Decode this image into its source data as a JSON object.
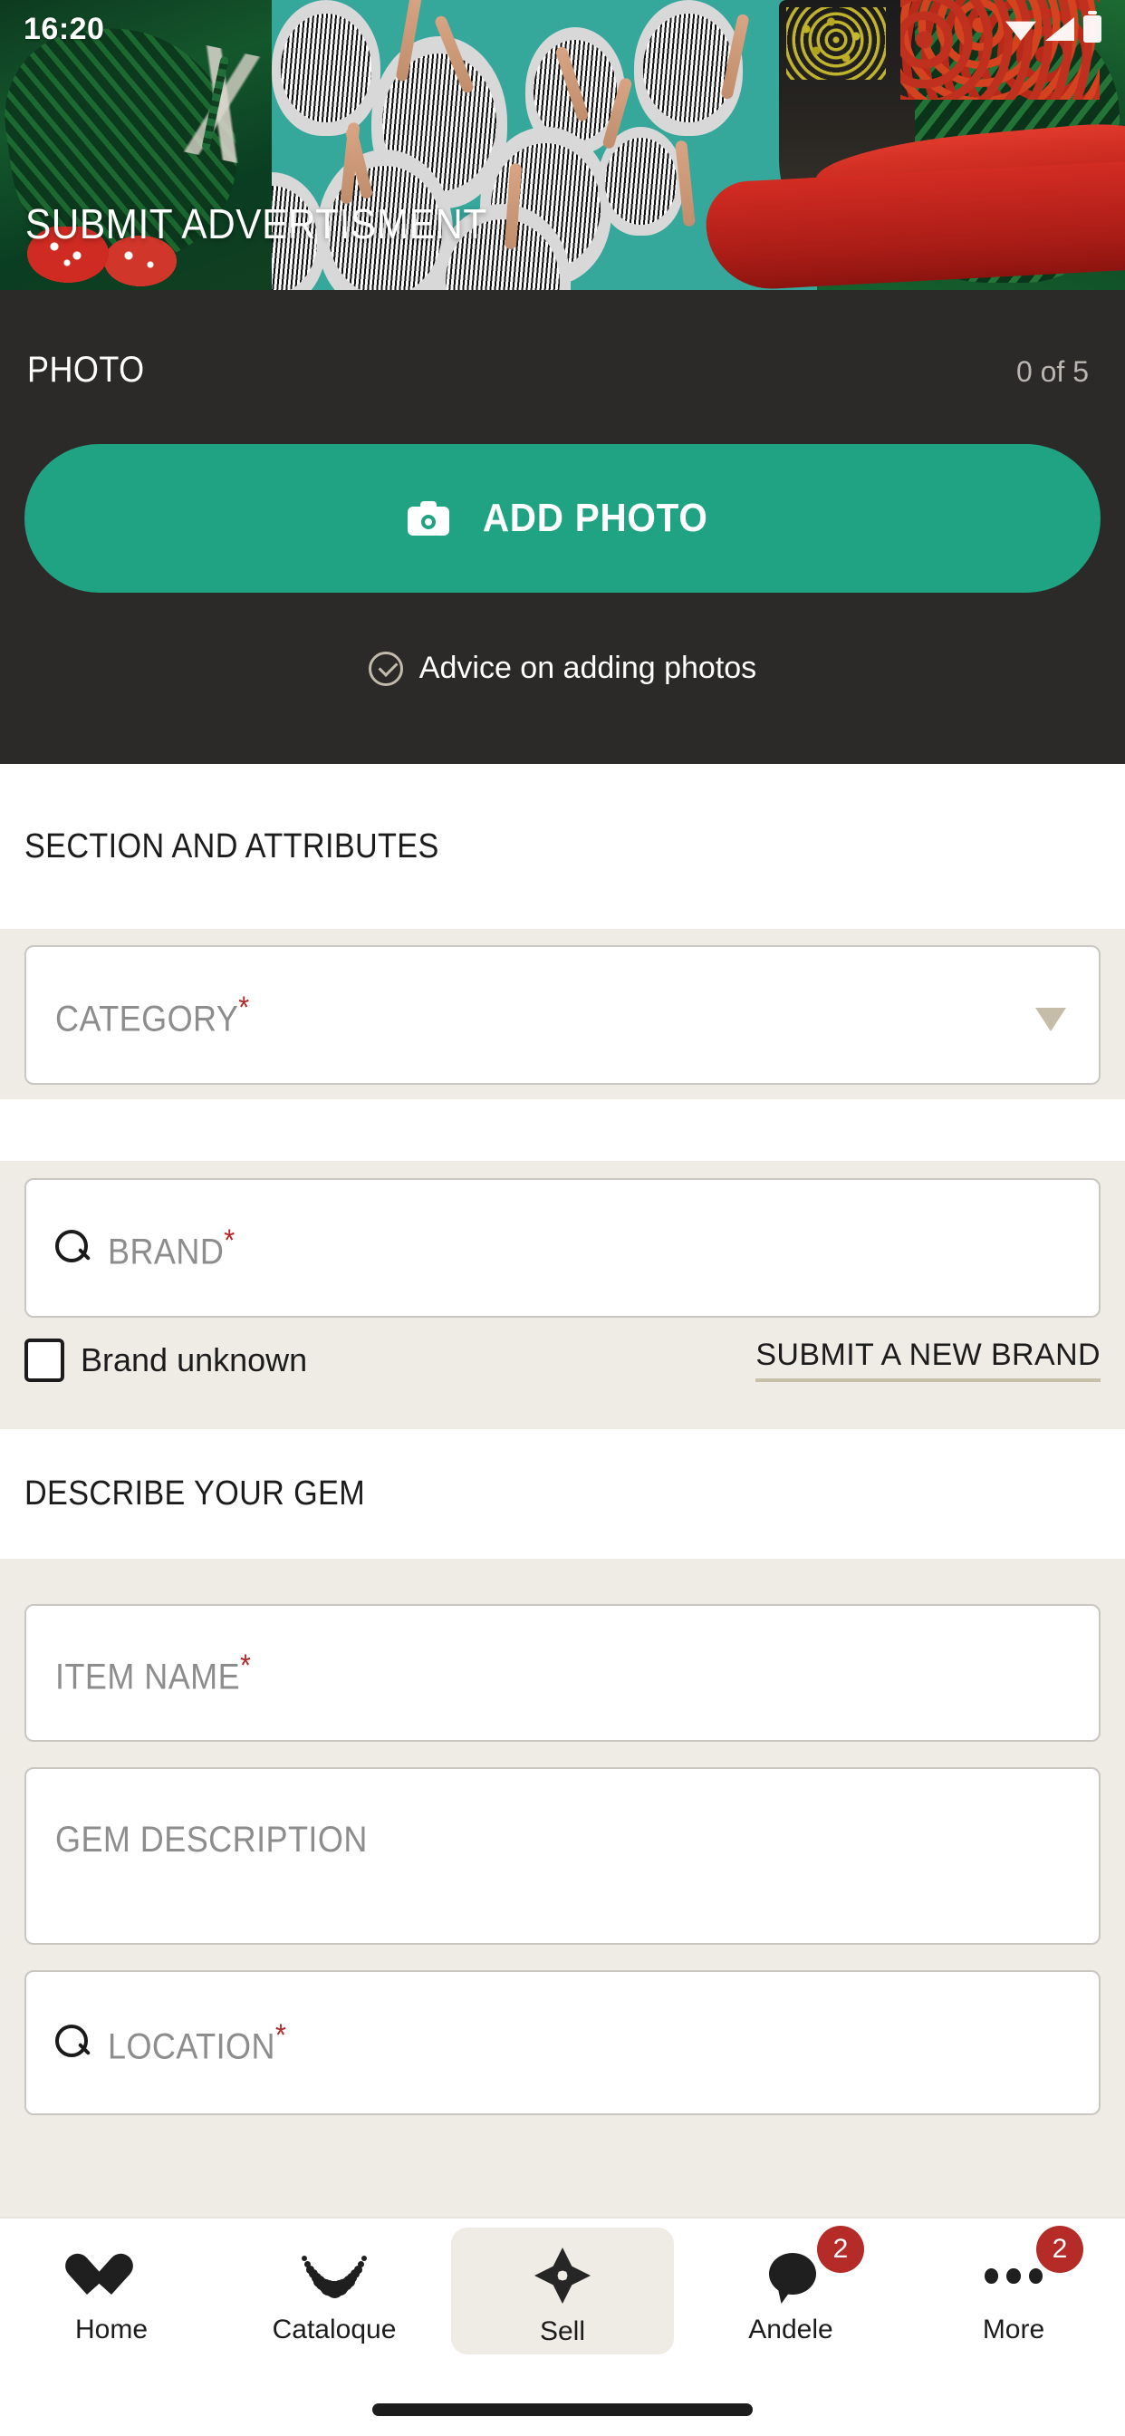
{
  "statusbar": {
    "time": "16:20",
    "icons": [
      "wifi-icon",
      "signal-icon",
      "battery-icon"
    ]
  },
  "header": {
    "title": "SUBMIT ADVERTISMENT"
  },
  "photo_section": {
    "label": "PHOTO",
    "count": "0 of 5",
    "add_photo_label": "ADD PHOTO",
    "add_photo_icon": "camera-icon",
    "advice_label": "Advice on adding photos",
    "advice_icon": "check-circle-icon",
    "background": "#2b2a28",
    "button_color": "#1fa383"
  },
  "section_attributes": {
    "title": "SECTION AND ATTRIBUTES",
    "category": {
      "label": "CATEGORY",
      "required": "*",
      "value": "",
      "icon": "chevron-down-icon"
    },
    "brand": {
      "label": "BRAND",
      "required": "*",
      "value": "",
      "icon": "search-icon"
    },
    "brand_unknown_label": "Brand unknown",
    "brand_unknown_checked": false,
    "submit_new_brand_label": "SUBMIT A NEW BRAND"
  },
  "describe_section": {
    "title": "DESCRIBE YOUR GEM",
    "item_name": {
      "label": "ITEM NAME",
      "required": "*",
      "value": ""
    },
    "gem_description": {
      "label": "GEM DESCRIPTION",
      "required": "",
      "value": ""
    },
    "location": {
      "label": "LOCATION",
      "required": "*",
      "value": "",
      "icon": "search-icon"
    }
  },
  "bottom_nav": {
    "items": [
      {
        "label": "Home",
        "icon": "heart-icon",
        "active": false,
        "badge": ""
      },
      {
        "label": "Cataloque",
        "icon": "necklace-icon",
        "active": false,
        "badge": ""
      },
      {
        "label": "Sell",
        "icon": "sparkle-icon",
        "active": true,
        "badge": ""
      },
      {
        "label": "Andele",
        "icon": "speech-bubble-icon",
        "active": false,
        "badge": "2"
      },
      {
        "label": "More",
        "icon": "more-dots-icon",
        "active": false,
        "badge": "2"
      }
    ],
    "badge_color": "#b52b27",
    "active_pill_color": "#eeece5"
  },
  "colors": {
    "accent_green": "#1fa383",
    "dark_panel": "#2b2a28",
    "beige": "#eeece5",
    "required_red": "#b0282a",
    "tan": "#c8bfa9"
  }
}
